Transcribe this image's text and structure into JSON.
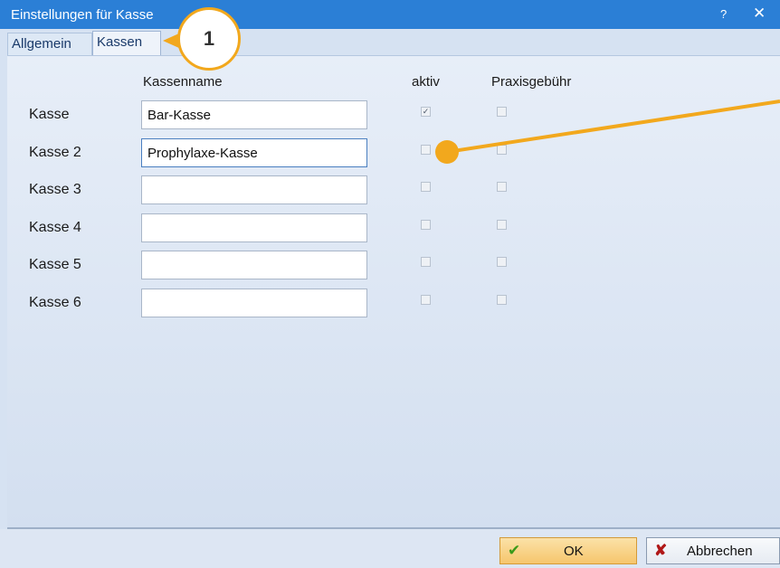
{
  "window": {
    "title": "Einstellungen für Kasse",
    "help_label": "?",
    "close_label": "✕"
  },
  "tabs": [
    {
      "label": "Allgemein"
    },
    {
      "label": "Kassen"
    }
  ],
  "columns": {
    "name": "Kassenname",
    "active": "aktiv",
    "fee": "Praxisgebühr"
  },
  "rows": [
    {
      "label": "Kasse",
      "name": "Bar-Kasse",
      "active": true,
      "fee": false
    },
    {
      "label": "Kasse 2",
      "name": "Prophylaxe-Kasse",
      "active": false,
      "fee": false
    },
    {
      "label": "Kasse 3",
      "name": "",
      "active": false,
      "fee": false
    },
    {
      "label": "Kasse 4",
      "name": "",
      "active": false,
      "fee": false
    },
    {
      "label": "Kasse 5",
      "name": "",
      "active": false,
      "fee": false
    },
    {
      "label": "Kasse 6",
      "name": "",
      "active": false,
      "fee": false
    }
  ],
  "buttons": {
    "ok": "OK",
    "cancel": "Abbrechen",
    "ok_icon": "checkmark-icon",
    "cancel_icon": "x-icon"
  },
  "annotations": {
    "callout_number": "1",
    "accent_color": "#f2a81d"
  }
}
